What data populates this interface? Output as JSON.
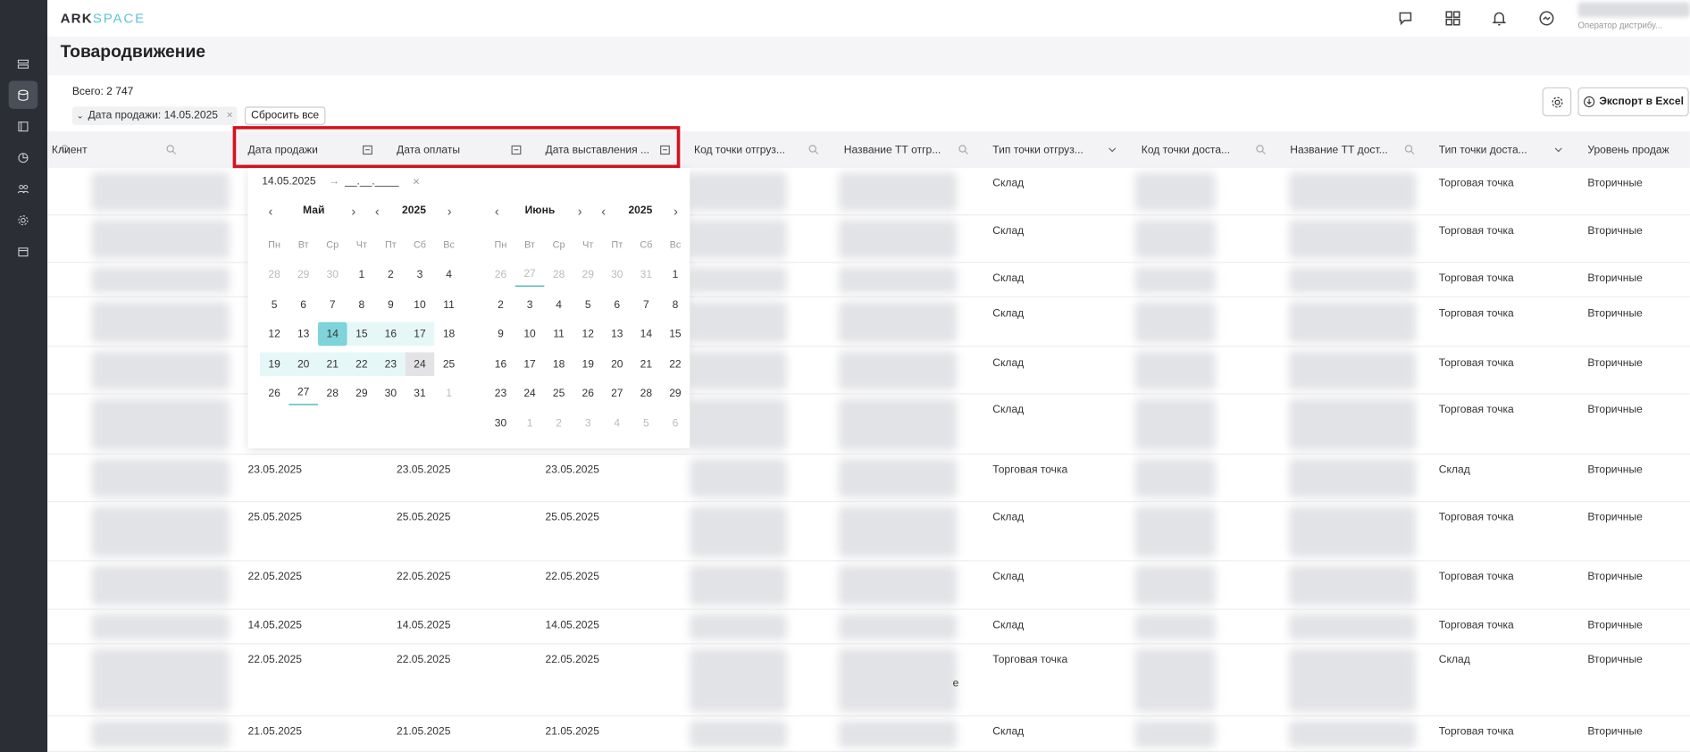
{
  "app": {
    "logo_a": "ARK",
    "logo_b": "SPACE",
    "user_role": "Оператор дистрибу..."
  },
  "page": {
    "title": "Товародвижение",
    "total": "Всего: 2 747"
  },
  "filters": {
    "chip": "Дата продажи: 14.05.2025",
    "chip_close": "×",
    "reset": "Сбросить все"
  },
  "toolbar": {
    "export": "Экспорт в Excel"
  },
  "columns": [
    "Клиент",
    "Дата продажи",
    "Дата оплаты",
    "Дата выставления ...",
    "Код точки отгруз...",
    "Название ТТ отгр...",
    "Тип точки отгруз...",
    "Код точки доста...",
    "Название ТТ дост...",
    "Тип точки доста...",
    "Уровень продаж"
  ],
  "datepicker": {
    "from": "14.05.2025",
    "arrow": "→",
    "to": "__.__.____",
    "clear": "×",
    "left": {
      "month": "Май",
      "year": "2025"
    },
    "right": {
      "month": "Июнь",
      "year": "2025"
    },
    "weekdays": [
      "Пн",
      "Вт",
      "Ср",
      "Чт",
      "Пт",
      "Сб",
      "Вс"
    ],
    "may": [
      "28",
      "29",
      "30",
      "1",
      "2",
      "3",
      "4",
      "5",
      "6",
      "7",
      "8",
      "9",
      "10",
      "11",
      "12",
      "13",
      "14",
      "15",
      "16",
      "17",
      "18",
      "19",
      "20",
      "21",
      "22",
      "23",
      "24",
      "25",
      "26",
      "27",
      "28",
      "29",
      "30",
      "31",
      "1"
    ],
    "june": [
      "26",
      "27",
      "28",
      "29",
      "30",
      "31",
      "1",
      "2",
      "3",
      "4",
      "5",
      "6",
      "7",
      "8",
      "9",
      "10",
      "11",
      "12",
      "13",
      "14",
      "15",
      "16",
      "17",
      "18",
      "19",
      "20",
      "21",
      "22",
      "23",
      "24",
      "25",
      "26",
      "27",
      "28",
      "29",
      "30",
      "1",
      "2",
      "3",
      "4",
      "5",
      "6"
    ]
  },
  "rows": [
    {
      "d1": "",
      "d2": "",
      "d3": "",
      "ship": "Склад",
      "deliv": "Торговая точка",
      "level": "Вторичные"
    },
    {
      "d1": "",
      "d2": "",
      "d3": "",
      "ship": "Склад",
      "deliv": "Торговая точка",
      "level": "Вторичные"
    },
    {
      "d1": "",
      "d2": "",
      "d3": "",
      "ship": "Склад",
      "deliv": "Торговая точка",
      "level": "Вторичные"
    },
    {
      "d1": "",
      "d2": "",
      "d3": "",
      "ship": "Склад",
      "deliv": "Торговая точка",
      "level": "Вторичные"
    },
    {
      "d1": "",
      "d2": "",
      "d3": "",
      "ship": "Склад",
      "deliv": "Торговая точка",
      "level": "Вторичные"
    },
    {
      "d1": "",
      "d2": "",
      "d3": "",
      "ship": "Склад",
      "deliv": "Торговая точка",
      "level": "Вторичные"
    },
    {
      "d1": "23.05.2025",
      "d2": "23.05.2025",
      "d3": "23.05.2025",
      "ship": "Торговая точка",
      "deliv": "Склад",
      "level": "Вторичные"
    },
    {
      "d1": "25.05.2025",
      "d2": "25.05.2025",
      "d3": "25.05.2025",
      "ship": "Склад",
      "deliv": "Торговая точка",
      "level": "Вторичные"
    },
    {
      "d1": "22.05.2025",
      "d2": "22.05.2025",
      "d3": "22.05.2025",
      "ship": "Склад",
      "deliv": "Торговая точка",
      "level": "Вторичные"
    },
    {
      "d1": "14.05.2025",
      "d2": "14.05.2025",
      "d3": "14.05.2025",
      "ship": "Склад",
      "deliv": "Торговая точка",
      "level": "Вторичные"
    },
    {
      "d1": "22.05.2025",
      "d2": "22.05.2025",
      "d3": "22.05.2025",
      "ship": "Торговая точка",
      "deliv": "Склад",
      "level": "Вторичные"
    },
    {
      "d1": "21.05.2025",
      "d2": "21.05.2025",
      "d3": "21.05.2025",
      "ship": "Склад",
      "deliv": "Торговая точка",
      "level": "Вторичные"
    }
  ],
  "stray_char": "е"
}
